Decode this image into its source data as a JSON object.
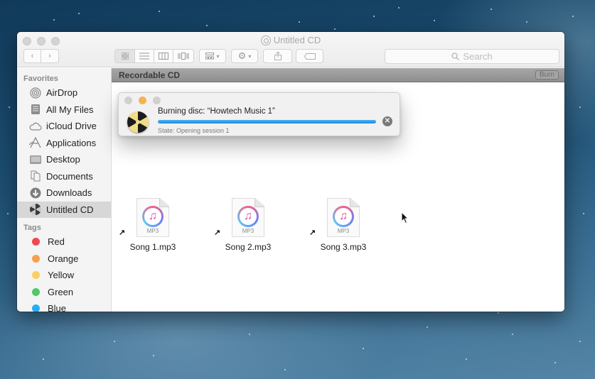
{
  "window": {
    "title": "Untitled CD",
    "search_placeholder": "Search"
  },
  "toolbar": {
    "back_icon": "‹",
    "forward_icon": "›",
    "view_modes": [
      "icon-view",
      "list-view",
      "column-view",
      "cover-flow-view"
    ],
    "active_view": "icon-view"
  },
  "sidebar": {
    "favorites_label": "Favorites",
    "items": [
      {
        "label": "AirDrop",
        "icon": "airdrop-icon"
      },
      {
        "label": "All My Files",
        "icon": "all-files-icon"
      },
      {
        "label": "iCloud Drive",
        "icon": "cloud-icon"
      },
      {
        "label": "Applications",
        "icon": "applications-icon"
      },
      {
        "label": "Desktop",
        "icon": "desktop-icon"
      },
      {
        "label": "Documents",
        "icon": "documents-icon"
      },
      {
        "label": "Downloads",
        "icon": "downloads-icon"
      },
      {
        "label": "Untitled CD",
        "icon": "burnable-disc-icon",
        "selected": true
      }
    ],
    "tags_label": "Tags",
    "tags": [
      {
        "label": "Red",
        "color": "#f0484f"
      },
      {
        "label": "Orange",
        "color": "#f6a04d"
      },
      {
        "label": "Yellow",
        "color": "#f8cf62"
      },
      {
        "label": "Green",
        "color": "#4fc965"
      },
      {
        "label": "Blue",
        "color": "#27aef2"
      }
    ]
  },
  "path_bar": {
    "label": "Recordable CD",
    "burn_label": "Burn"
  },
  "files": [
    {
      "name": "Song 1.mp3",
      "type_label": "MP3"
    },
    {
      "name": "Song 2.mp3",
      "type_label": "MP3"
    },
    {
      "name": "Song 3.mp3",
      "type_label": "MP3"
    }
  ],
  "burn_dialog": {
    "title": "Burning disc: “Howtech Music 1”",
    "state": "State: Opening session 1",
    "progress_percent": 100,
    "cancel_icon": "✕"
  }
}
